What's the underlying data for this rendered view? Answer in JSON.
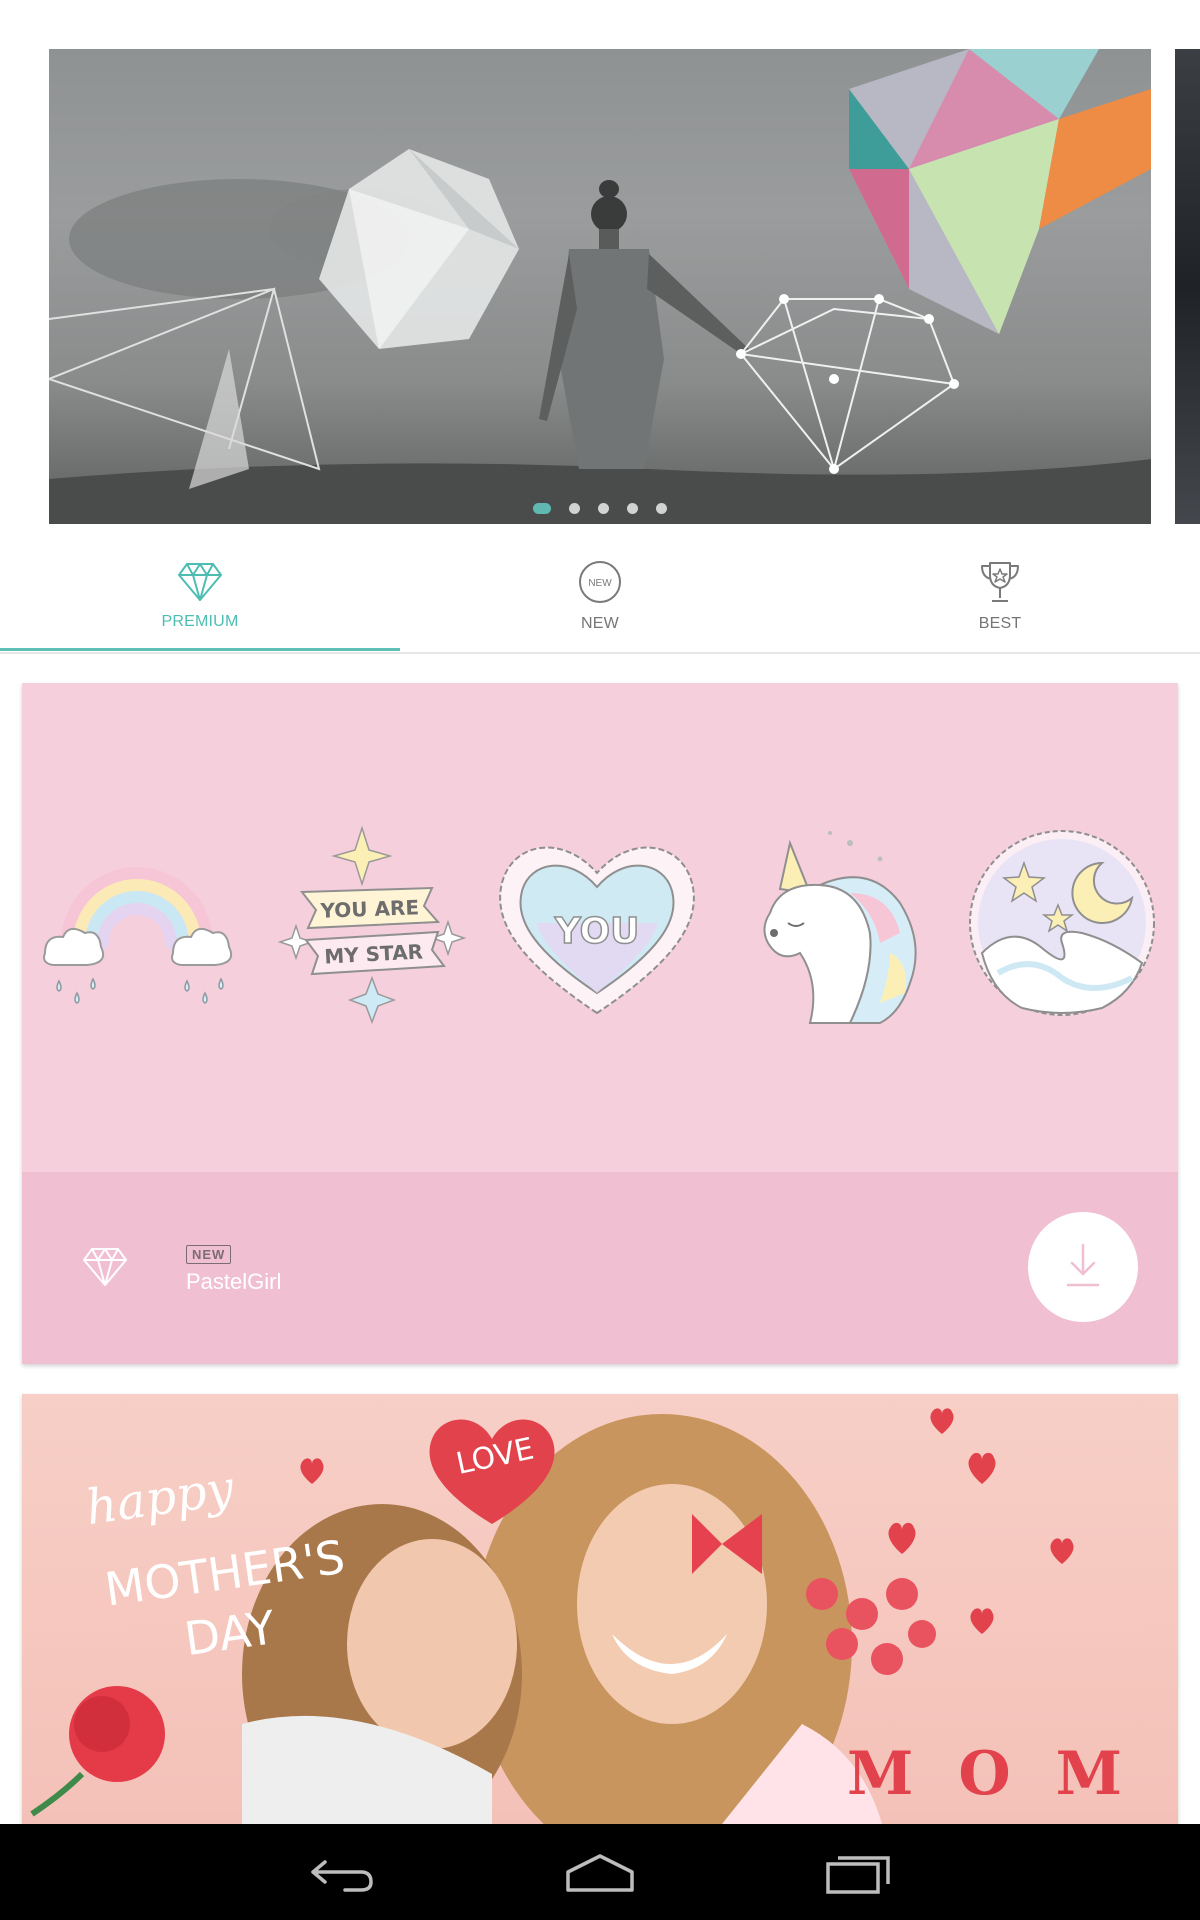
{
  "carousel": {
    "slide_count": 5,
    "active_index": 0,
    "accent_color": "#5fb8b2"
  },
  "tabs": [
    {
      "label": "PREMIUM",
      "icon": "diamond-icon",
      "active": true
    },
    {
      "label": "NEW",
      "icon": "new-circle-icon",
      "icon_text": "NEW",
      "active": false
    },
    {
      "label": "BEST",
      "icon": "trophy-icon",
      "active": false
    }
  ],
  "packs": [
    {
      "badge": "NEW",
      "name": "PastelGirl",
      "tier_icon": "diamond-icon",
      "action_icon": "download-icon",
      "stickers": [
        {
          "name": "rainbow-sticker"
        },
        {
          "name": "you-are-my-star-sticker",
          "text_line1": "YOU ARE",
          "text_line2": "MY STAR"
        },
        {
          "name": "heart-you-sticker",
          "text": "YOU"
        },
        {
          "name": "unicorn-sticker"
        },
        {
          "name": "moon-waves-sticker"
        }
      ],
      "colors": {
        "background": "#f6cfdd",
        "footer": "#f1bfd2"
      }
    },
    {
      "name": "happy MOTHER'S DAY",
      "text_line1": "happy",
      "text_line2": "MOTHER'S",
      "text_line3": "DAY",
      "heart_text": "LOVE",
      "letters": "MOM"
    }
  ],
  "navbar": {
    "buttons": [
      {
        "icon": "back-icon"
      },
      {
        "icon": "home-icon"
      },
      {
        "icon": "recent-apps-icon"
      }
    ]
  }
}
